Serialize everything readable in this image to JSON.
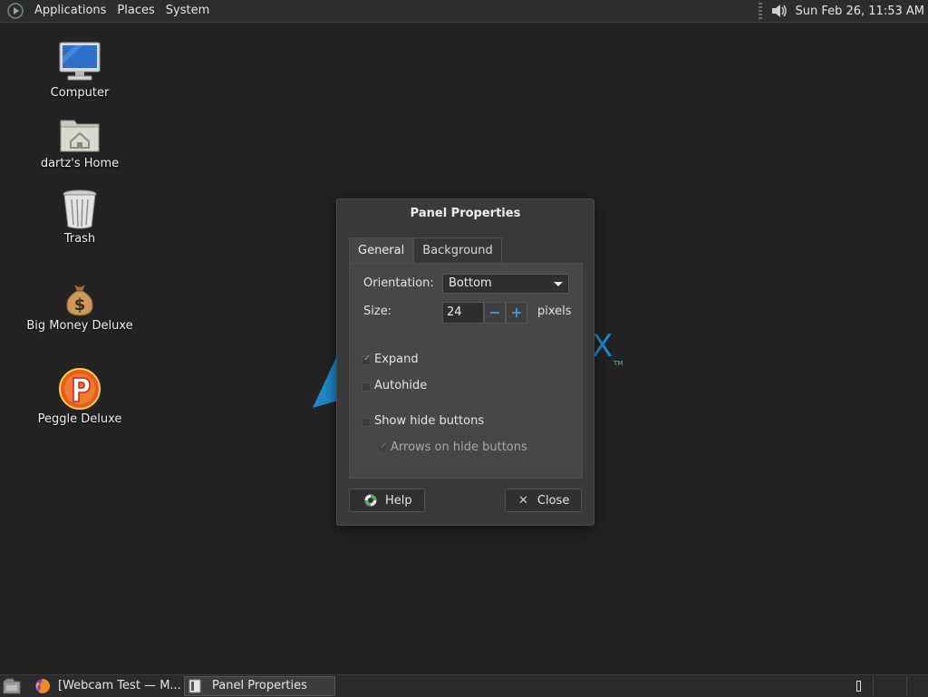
{
  "top_panel": {
    "menus": [
      "Applications",
      "Places",
      "System"
    ],
    "clock": "Sun Feb 26, 11:53 AM",
    "icons": {
      "launcher": "distro-logo-icon",
      "volume": "speaker-icon"
    }
  },
  "desktop": {
    "icons": [
      {
        "label": "Computer",
        "icon": "computer-icon"
      },
      {
        "label": "dartz's Home",
        "icon": "home-folder-icon"
      },
      {
        "label": "Trash",
        "icon": "trash-icon"
      },
      {
        "label": "Big Money Deluxe",
        "icon": "money-bag-icon"
      },
      {
        "label": "Peggle Deluxe",
        "icon": "peggle-icon"
      }
    ],
    "watermark": {
      "letter": "X",
      "tm": "TM"
    }
  },
  "dialog": {
    "title": "Panel Properties",
    "tabs": [
      {
        "label": "General",
        "active": true
      },
      {
        "label": "Background",
        "active": false
      }
    ],
    "orientation": {
      "label": "Orientation:",
      "value": "Bottom"
    },
    "size": {
      "label": "Size:",
      "value": "24",
      "unit": "pixels",
      "minus": "−",
      "plus": "+"
    },
    "checks": [
      {
        "label": "Expand",
        "checked": true,
        "enabled": true
      },
      {
        "label": "Autohide",
        "checked": false,
        "enabled": true
      },
      {
        "label": "Show hide buttons",
        "checked": false,
        "enabled": true
      },
      {
        "label": "Arrows on hide buttons",
        "checked": true,
        "enabled": false
      }
    ],
    "help_label": "Help",
    "close_label": "Close",
    "close_glyph": "✕"
  },
  "bottom_panel": {
    "tasks": [
      {
        "label": "[Webcam Test — M...",
        "icon": "firefox-icon"
      },
      {
        "label": "Panel Properties",
        "icon": "window-icon",
        "active": true
      }
    ]
  },
  "colors": {
    "accent": "#4a90d9",
    "desktop_bg": "#222322",
    "dialog_bg": "#393a39"
  }
}
